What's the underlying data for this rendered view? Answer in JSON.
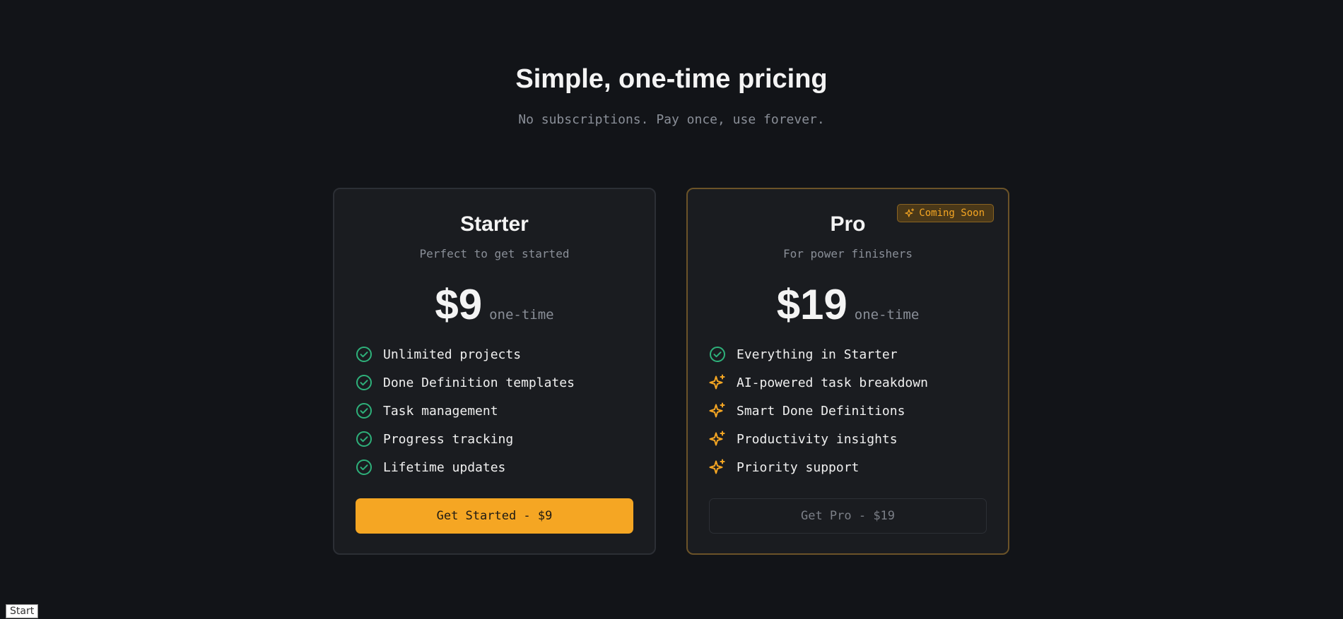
{
  "hero": {
    "title": "Simple, one-time pricing",
    "subtitle": "No subscriptions. Pay once, use forever."
  },
  "colors": {
    "background": "#121418",
    "card": "#1a1c20",
    "accent": "#f5a623",
    "check": "#2eb07a"
  },
  "plans": [
    {
      "name": "Starter",
      "tagline": "Perfect to get started",
      "price": "$9",
      "period": "one-time",
      "features": [
        {
          "icon": "check-circle-icon",
          "label": "Unlimited projects"
        },
        {
          "icon": "check-circle-icon",
          "label": "Done Definition templates"
        },
        {
          "icon": "check-circle-icon",
          "label": "Task management"
        },
        {
          "icon": "check-circle-icon",
          "label": "Progress tracking"
        },
        {
          "icon": "check-circle-icon",
          "label": "Lifetime updates"
        }
      ],
      "cta": "Get Started - $9"
    },
    {
      "name": "Pro",
      "tagline": "For power finishers",
      "price": "$19",
      "period": "one-time",
      "badge": {
        "icon": "sparkles-icon",
        "label": "Coming Soon"
      },
      "features": [
        {
          "icon": "check-circle-icon",
          "label": "Everything in Starter"
        },
        {
          "icon": "sparkles-icon",
          "label": "AI-powered task breakdown"
        },
        {
          "icon": "sparkles-icon",
          "label": "Smart Done Definitions"
        },
        {
          "icon": "sparkles-icon",
          "label": "Productivity insights"
        },
        {
          "icon": "sparkles-icon",
          "label": "Priority support"
        }
      ],
      "cta": "Get Pro - $19"
    }
  ],
  "taskbar": {
    "start_label": "Start"
  }
}
